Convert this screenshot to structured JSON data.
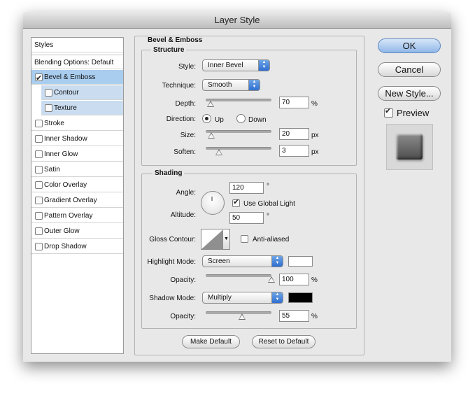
{
  "window": {
    "title": "Layer Style"
  },
  "styles_list": {
    "header": "Styles",
    "items": [
      {
        "label": "Blending Options: Default",
        "checked": false
      },
      {
        "label": "Bevel & Emboss",
        "checked": true
      },
      {
        "label": "Contour",
        "checked": false
      },
      {
        "label": "Texture",
        "checked": false
      },
      {
        "label": "Stroke",
        "checked": false
      },
      {
        "label": "Inner Shadow",
        "checked": false
      },
      {
        "label": "Inner Glow",
        "checked": false
      },
      {
        "label": "Satin",
        "checked": false
      },
      {
        "label": "Color Overlay",
        "checked": false
      },
      {
        "label": "Gradient Overlay",
        "checked": false
      },
      {
        "label": "Pattern Overlay",
        "checked": false
      },
      {
        "label": "Outer Glow",
        "checked": false
      },
      {
        "label": "Drop Shadow",
        "checked": false
      }
    ]
  },
  "bevel": {
    "title": "Bevel & Emboss",
    "structure": {
      "title": "Structure",
      "style_label": "Style:",
      "style_value": "Inner Bevel",
      "technique_label": "Technique:",
      "technique_value": "Smooth",
      "depth_label": "Depth:",
      "depth_value": "70",
      "depth_unit": "%",
      "depth_slider": 0.07,
      "direction_label": "Direction:",
      "up_label": "Up",
      "down_label": "Down",
      "direction_selected": "Up",
      "size_label": "Size:",
      "size_value": "20",
      "size_unit": "px",
      "size_slider": 0.08,
      "soften_label": "Soften:",
      "soften_value": "3",
      "soften_unit": "px",
      "soften_slider": 0.2
    },
    "shading": {
      "title": "Shading",
      "angle_label": "Angle:",
      "angle_value": "120",
      "angle_unit": "°",
      "global_light_label": "Use Global Light",
      "global_light_checked": true,
      "altitude_label": "Altitude:",
      "altitude_value": "50",
      "altitude_unit": "°",
      "gloss_label": "Gloss Contour:",
      "anti_aliased_label": "Anti-aliased",
      "anti_aliased_checked": false,
      "highlight_mode_label": "Highlight Mode:",
      "highlight_mode_value": "Screen",
      "highlight_color": "#ffffff",
      "highlight_opacity_label": "Opacity:",
      "highlight_opacity_value": "100",
      "highlight_opacity_unit": "%",
      "highlight_opacity_slider": 1.0,
      "shadow_mode_label": "Shadow Mode:",
      "shadow_mode_value": "Multiply",
      "shadow_color": "#000000",
      "shadow_opacity_label": "Opacity:",
      "shadow_opacity_value": "55",
      "shadow_opacity_unit": "%",
      "shadow_opacity_slider": 0.55
    },
    "make_default_label": "Make Default",
    "reset_default_label": "Reset to Default"
  },
  "buttons": {
    "ok": "OK",
    "cancel": "Cancel",
    "new_style": "New Style...",
    "preview_label": "Preview",
    "preview_checked": true
  }
}
